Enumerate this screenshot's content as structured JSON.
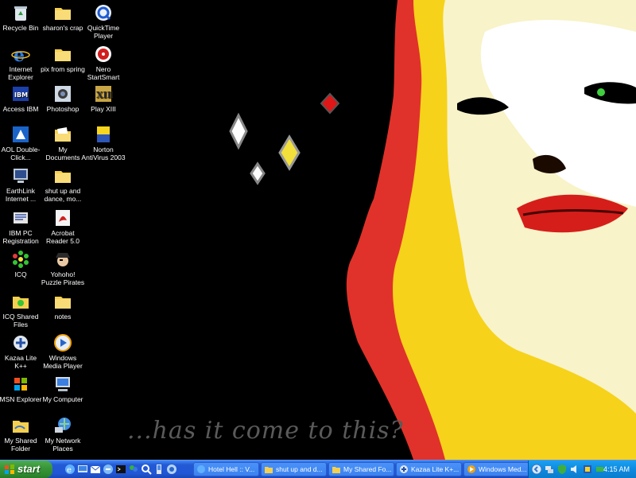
{
  "desktop": {
    "caption": "...has it come to this?",
    "icons": [
      {
        "label": "Recycle Bin",
        "icon": "recycle-bin-icon"
      },
      {
        "label": "sharon's crap",
        "icon": "folder-icon"
      },
      {
        "label": "QuickTime Player",
        "icon": "quicktime-icon"
      },
      {
        "label": "Internet Explorer",
        "icon": "internet-explorer-icon"
      },
      {
        "label": "pix from spring",
        "icon": "folder-icon"
      },
      {
        "label": "Nero StartSmart",
        "icon": "nero-icon"
      },
      {
        "label": "Access IBM",
        "icon": "ibm-icon"
      },
      {
        "label": "Photoshop",
        "icon": "photoshop-icon"
      },
      {
        "label": "Play XIII",
        "icon": "xiii-game-icon"
      },
      {
        "label": "AOL Double-Click...",
        "icon": "aol-icon"
      },
      {
        "label": "My Documents",
        "icon": "my-documents-icon"
      },
      {
        "label": "Norton AntiVirus 2003",
        "icon": "norton-icon"
      },
      {
        "label": "EarthLink Internet ...",
        "icon": "earthlink-icon"
      },
      {
        "label": "shut up and dance, mo...",
        "icon": "folder-icon"
      },
      {
        "label": "IBM PC Registration",
        "icon": "registration-icon"
      },
      {
        "label": "Acrobat Reader 5.0",
        "icon": "acrobat-icon"
      },
      {
        "label": "ICQ",
        "icon": "icq-icon"
      },
      {
        "label": "Yohoho! Puzzle Pirates",
        "icon": "pirate-icon"
      },
      {
        "label": "ICQ Shared Files",
        "icon": "icq-shared-icon"
      },
      {
        "label": "notes",
        "icon": "folder-icon"
      },
      {
        "label": "Kazaa Lite K++",
        "icon": "kazaa-icon"
      },
      {
        "label": "Windows Media Player",
        "icon": "media-player-icon"
      },
      {
        "label": "MSN Explorer",
        "icon": "msn-icon"
      },
      {
        "label": "My Computer",
        "icon": "my-computer-icon"
      },
      {
        "label": "My Shared Folder",
        "icon": "shared-folder-icon"
      },
      {
        "label": "My Network Places",
        "icon": "network-places-icon"
      }
    ]
  },
  "taskbar": {
    "start_label": "start",
    "quick_launch": [
      "ie-icon",
      "desktop-icon",
      "outlook-icon",
      "explorer-icon",
      "media-icon",
      "cmd-icon",
      "messenger-icon",
      "search-icon",
      "pda-icon",
      "finder-icon"
    ],
    "tasks": [
      {
        "label": "Hotel Hell :: V...",
        "icon": "ie-icon"
      },
      {
        "label": "shut up and d...",
        "icon": "folder-icon"
      },
      {
        "label": "My Shared Fo...",
        "icon": "folder-icon"
      },
      {
        "label": "Kazaa Lite K+...",
        "icon": "kazaa-icon"
      },
      {
        "label": "Windows Med...",
        "icon": "media-player-icon"
      }
    ],
    "tray_icons": [
      "expand-icon",
      "network-icon",
      "security-icon",
      "volume-icon",
      "tray-app-icon",
      "power-icon"
    ],
    "clock": "4:15 AM"
  },
  "colors": {
    "taskbar_blue": "#2459d4",
    "start_green": "#3a963a",
    "tray_blue": "#0e8ae0"
  }
}
